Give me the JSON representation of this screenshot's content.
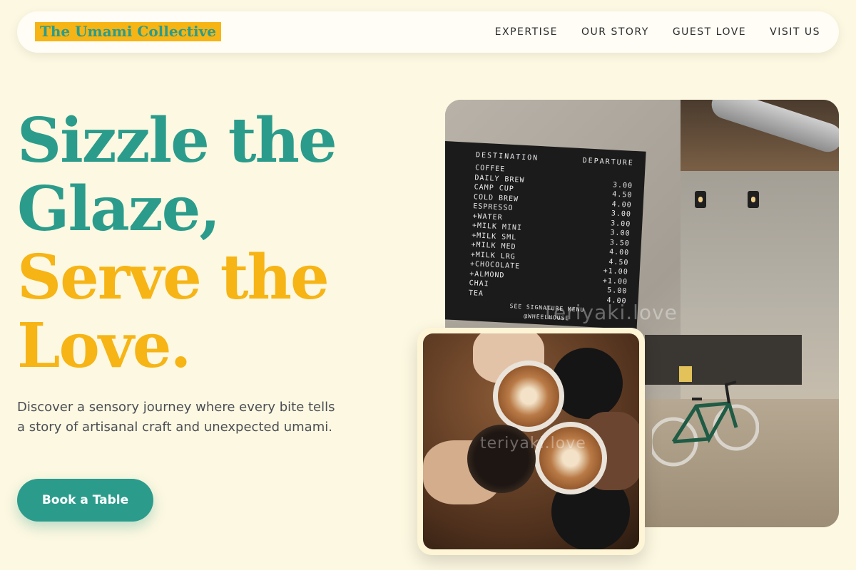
{
  "brand": {
    "name": "The Umami Collective"
  },
  "nav": {
    "items": [
      "EXPERTISE",
      "OUR STORY",
      "GUEST LOVE",
      "VISIT US"
    ]
  },
  "hero": {
    "headline": [
      "Sizzle the",
      "Glaze,",
      "Serve the",
      "Love."
    ],
    "subtitle": "Discover a sensory journey where every bite tells a story of artisanal craft and unexpected umami.",
    "cta_label": "Book a Table"
  },
  "board": {
    "title": "DESTINATION",
    "departure_label": "DEPARTURE",
    "rows": [
      [
        "COFFEE",
        ""
      ],
      [
        "DAILY BREW",
        "3.00"
      ],
      [
        "CAMP CUP",
        "4.50"
      ],
      [
        "COLD BREW",
        "4.00"
      ],
      [
        "ESPRESSO",
        "3.00"
      ],
      [
        "+WATER",
        "3.00"
      ],
      [
        "+MILK MINI",
        "3.00"
      ],
      [
        "+MILK SML",
        "3.50"
      ],
      [
        "+MILK MED",
        "4.00"
      ],
      [
        "+MILK LRG",
        "4.50"
      ],
      [
        "+CHOCOLATE",
        "+1.00"
      ],
      [
        "+ALMOND",
        "+1.00"
      ],
      [
        "CHAI",
        "5.00"
      ],
      [
        "TEA",
        "4.00"
      ]
    ],
    "footer": "SEE SIGNATURE MENU",
    "footer_small": "@WHEELHOUSE"
  },
  "watermark": "teriyaki.love",
  "colors": {
    "teal": "#2b9c8c",
    "gold": "#f6b415",
    "background": "#fdf8e1"
  }
}
